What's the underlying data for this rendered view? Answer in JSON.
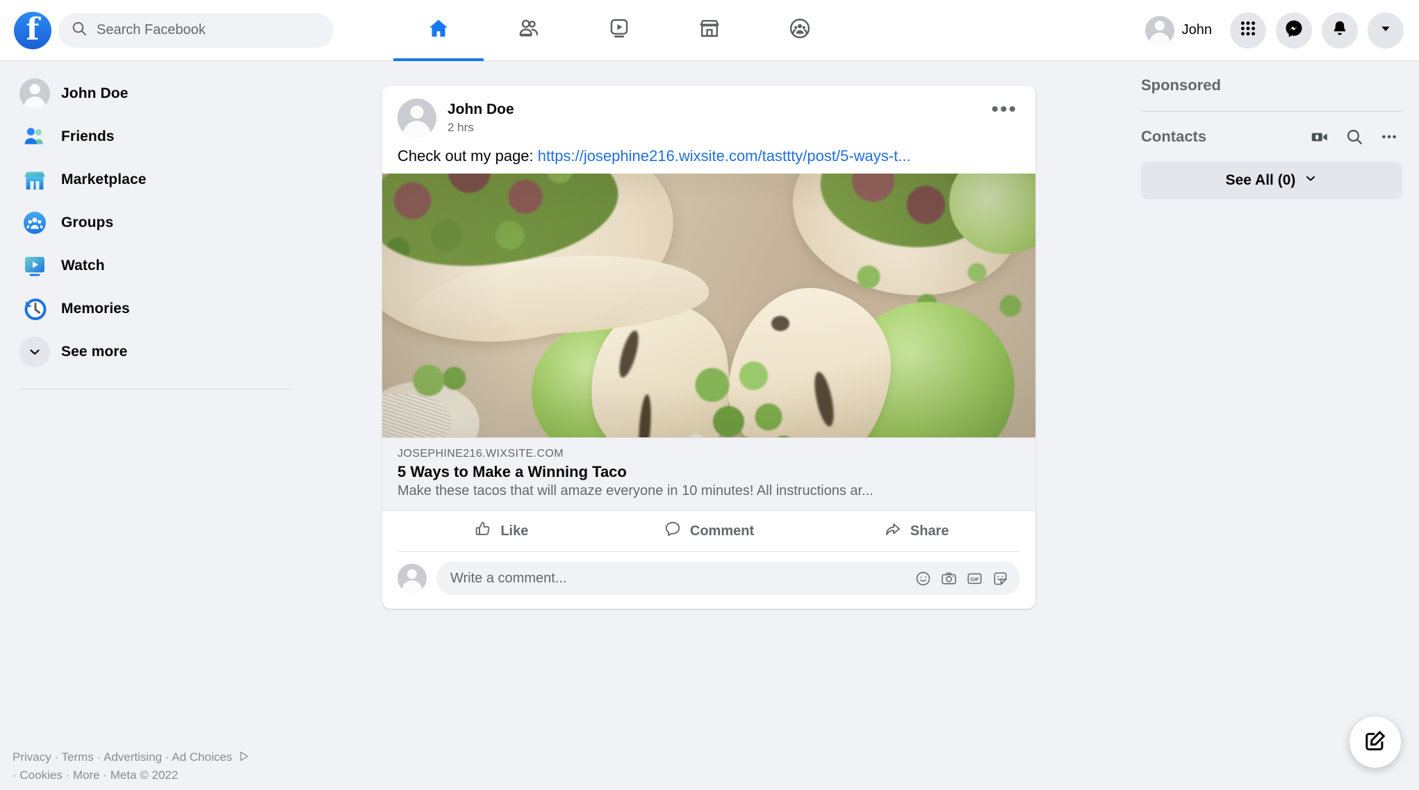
{
  "header": {
    "logo_icon": "facebook-logo-icon",
    "search": {
      "placeholder": "Search Facebook",
      "value": "",
      "icon": "search-icon"
    },
    "nav_tabs": [
      {
        "name": "home",
        "icon": "home-icon",
        "active": true
      },
      {
        "name": "friends",
        "icon": "friends-icon",
        "active": false
      },
      {
        "name": "watch",
        "icon": "watch-icon",
        "active": false
      },
      {
        "name": "marketplace",
        "icon": "marketplace-icon",
        "active": false
      },
      {
        "name": "groups",
        "icon": "groups-icon",
        "active": false
      }
    ],
    "profile_name": "John",
    "right_buttons": [
      {
        "name": "menu-grid-button",
        "icon": "grid-apps-icon"
      },
      {
        "name": "messenger-button",
        "icon": "messenger-icon"
      },
      {
        "name": "notifications-button",
        "icon": "bell-icon"
      },
      {
        "name": "account-menu-button",
        "icon": "chevron-down-icon"
      }
    ]
  },
  "sidebar": {
    "items": [
      {
        "label": "John Doe",
        "icon": "avatar-icon"
      },
      {
        "label": "Friends",
        "icon": "friends-icon"
      },
      {
        "label": "Marketplace",
        "icon": "marketplace-icon"
      },
      {
        "label": "Groups",
        "icon": "groups-icon"
      },
      {
        "label": "Watch",
        "icon": "watch-icon"
      },
      {
        "label": "Memories",
        "icon": "memories-clock-icon"
      },
      {
        "label": "See more",
        "icon": "chevron-down-icon"
      }
    ]
  },
  "footer": {
    "line1": "Privacy · Terms · Advertising · Ad Choices",
    "adchoices_icon": "ad-choices-icon",
    "line2": "· Cookies · More · Meta © 2022"
  },
  "post": {
    "author": "John Doe",
    "timestamp": "2 hrs",
    "more_icon": "more-options-icon",
    "text_prefix": "Check out my page: ",
    "link_text": "https://josephine216.wixsite.com/tasttty/post/5-ways-t...",
    "photo_alt": "taco-photo",
    "link_preview": {
      "domain": "JOSEPHINE216.WIXSITE.COM",
      "title": "5 Ways to Make a Winning Taco",
      "description": "Make these tacos that will amaze everyone in 10 minutes! All instructions ar..."
    },
    "actions": [
      {
        "label": "Like",
        "icon": "thumbs-up-icon"
      },
      {
        "label": "Comment",
        "icon": "comment-bubble-icon"
      },
      {
        "label": "Share",
        "icon": "share-arrow-icon"
      }
    ],
    "comment_box": {
      "placeholder": "Write a comment...",
      "value": "",
      "icons": [
        {
          "name": "emoji-icon",
          "label": "emoji"
        },
        {
          "name": "camera-icon",
          "label": "camera"
        },
        {
          "name": "gif-icon",
          "label": "GIF"
        },
        {
          "name": "sticker-icon",
          "label": "sticker"
        }
      ]
    }
  },
  "right_sidebar": {
    "sponsored_title": "Sponsored",
    "contacts_title": "Contacts",
    "contact_actions": [
      {
        "name": "new-video-room-icon"
      },
      {
        "name": "search-contacts-icon"
      },
      {
        "name": "contacts-options-icon"
      }
    ],
    "see_all_label": "See All (0)",
    "see_all_icon": "chevron-down-icon"
  },
  "fab": {
    "name": "create-post-fab",
    "icon": "pencil-square-icon"
  },
  "colors": {
    "brand_blue": "#1877f2",
    "link_blue": "#216fdb",
    "page_bg": "#f0f2f5",
    "card_bg": "#ffffff",
    "muted_text": "#65676b",
    "chip_bg": "#e4e6eb"
  }
}
